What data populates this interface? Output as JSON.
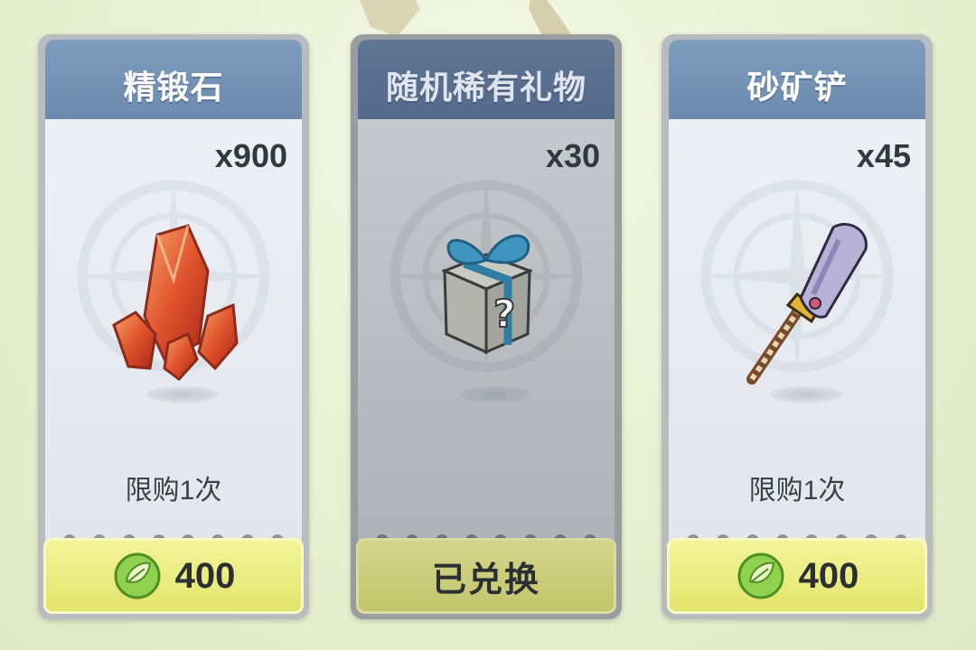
{
  "cards": [
    {
      "title": "精锻石",
      "quantity": "x900",
      "limit": "限购1次",
      "price": "400",
      "icon": "forging-crystal-icon"
    },
    {
      "title": "随机稀有礼物",
      "quantity": "x30",
      "limit": "",
      "status": "已兑换",
      "icon": "mystery-gift-box-icon"
    },
    {
      "title": "砂矿铲",
      "quantity": "x45",
      "limit": "限购1次",
      "price": "400",
      "icon": "shovel-icon"
    }
  ],
  "currency_icon": "leaf-currency-icon",
  "colors": {
    "title_bar": "#7393b5",
    "buy_button": "#ecee80",
    "accent_green": "#6bbf3a"
  }
}
